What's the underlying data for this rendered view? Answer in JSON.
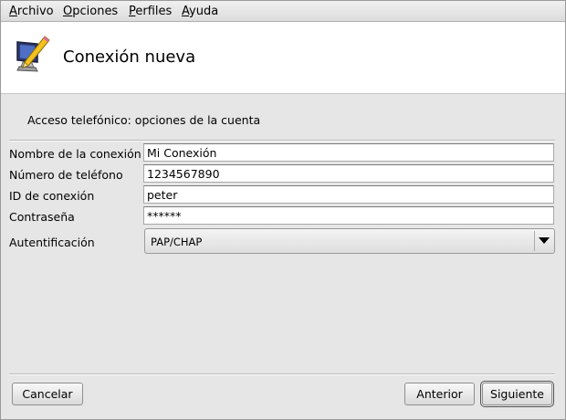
{
  "menubar": {
    "items": [
      {
        "accel": "A",
        "rest": "rchivo"
      },
      {
        "accel": "O",
        "rest": "pciones"
      },
      {
        "accel": "P",
        "rest": "erfiles"
      },
      {
        "accel": "A",
        "rest": "yuda"
      }
    ]
  },
  "header": {
    "title": "Conexión nueva",
    "icon": "monitor-pencil-icon"
  },
  "section": {
    "heading": "Acceso telefónico: opciones de la cuenta"
  },
  "form": {
    "name_label": "Nombre de la conexión",
    "name_value": "Mi Conexión",
    "phone_label": "Número de teléfono",
    "phone_value": "1234567890",
    "login_label": "ID de conexión",
    "login_value": "peter",
    "password_label": "Contraseña",
    "password_value": "******",
    "auth_label": "Autentificación",
    "auth_value": "PAP/CHAP"
  },
  "buttons": {
    "cancel": "Cancelar",
    "back": "Anterior",
    "next": "Siguiente"
  }
}
